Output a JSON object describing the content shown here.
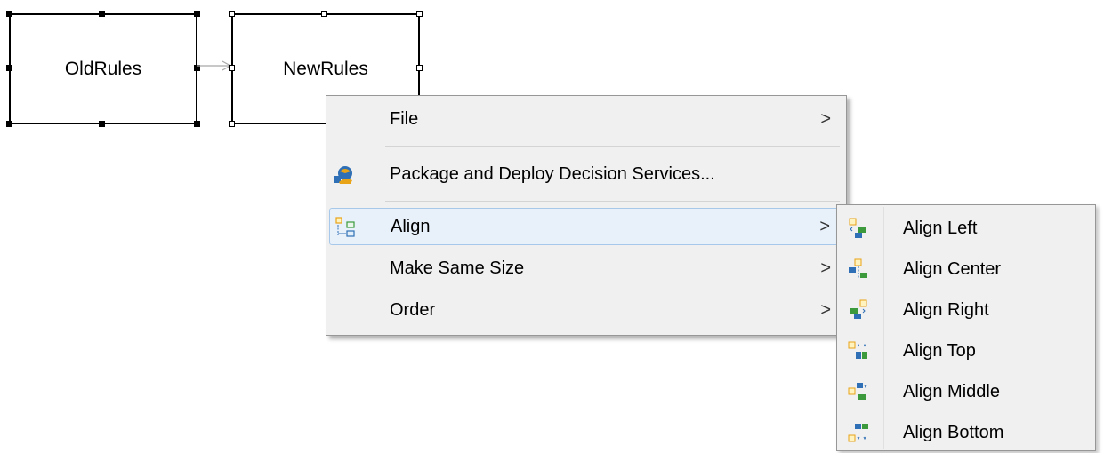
{
  "diagram": {
    "nodes": [
      {
        "label": "OldRules"
      },
      {
        "label": "NewRules"
      }
    ]
  },
  "context_menu": {
    "items": [
      {
        "label": "File",
        "icon": null,
        "has_submenu": true
      },
      {
        "label": "Package and Deploy Decision Services...",
        "icon": "package-deploy-icon",
        "has_submenu": false
      },
      {
        "label": "Align",
        "icon": "align-icon",
        "has_submenu": true,
        "highlighted": true
      },
      {
        "label": "Make Same Size",
        "icon": null,
        "has_submenu": true
      },
      {
        "label": "Order",
        "icon": null,
        "has_submenu": true
      }
    ],
    "submenu_arrow": ">"
  },
  "align_submenu": {
    "items": [
      {
        "label": "Align Left",
        "icon": "align-left-icon"
      },
      {
        "label": "Align Center",
        "icon": "align-center-icon"
      },
      {
        "label": "Align Right",
        "icon": "align-right-icon"
      },
      {
        "label": "Align Top",
        "icon": "align-top-icon"
      },
      {
        "label": "Align Middle",
        "icon": "align-middle-icon"
      },
      {
        "label": "Align Bottom",
        "icon": "align-bottom-icon"
      }
    ]
  },
  "colors": {
    "menu_bg": "#f0f0f0",
    "highlight_bg": "#e8f0fa",
    "highlight_border": "#a8c8ea",
    "icon_orange": "#e8a317",
    "icon_green": "#3c9a3c",
    "icon_blue": "#2f6fb5"
  }
}
